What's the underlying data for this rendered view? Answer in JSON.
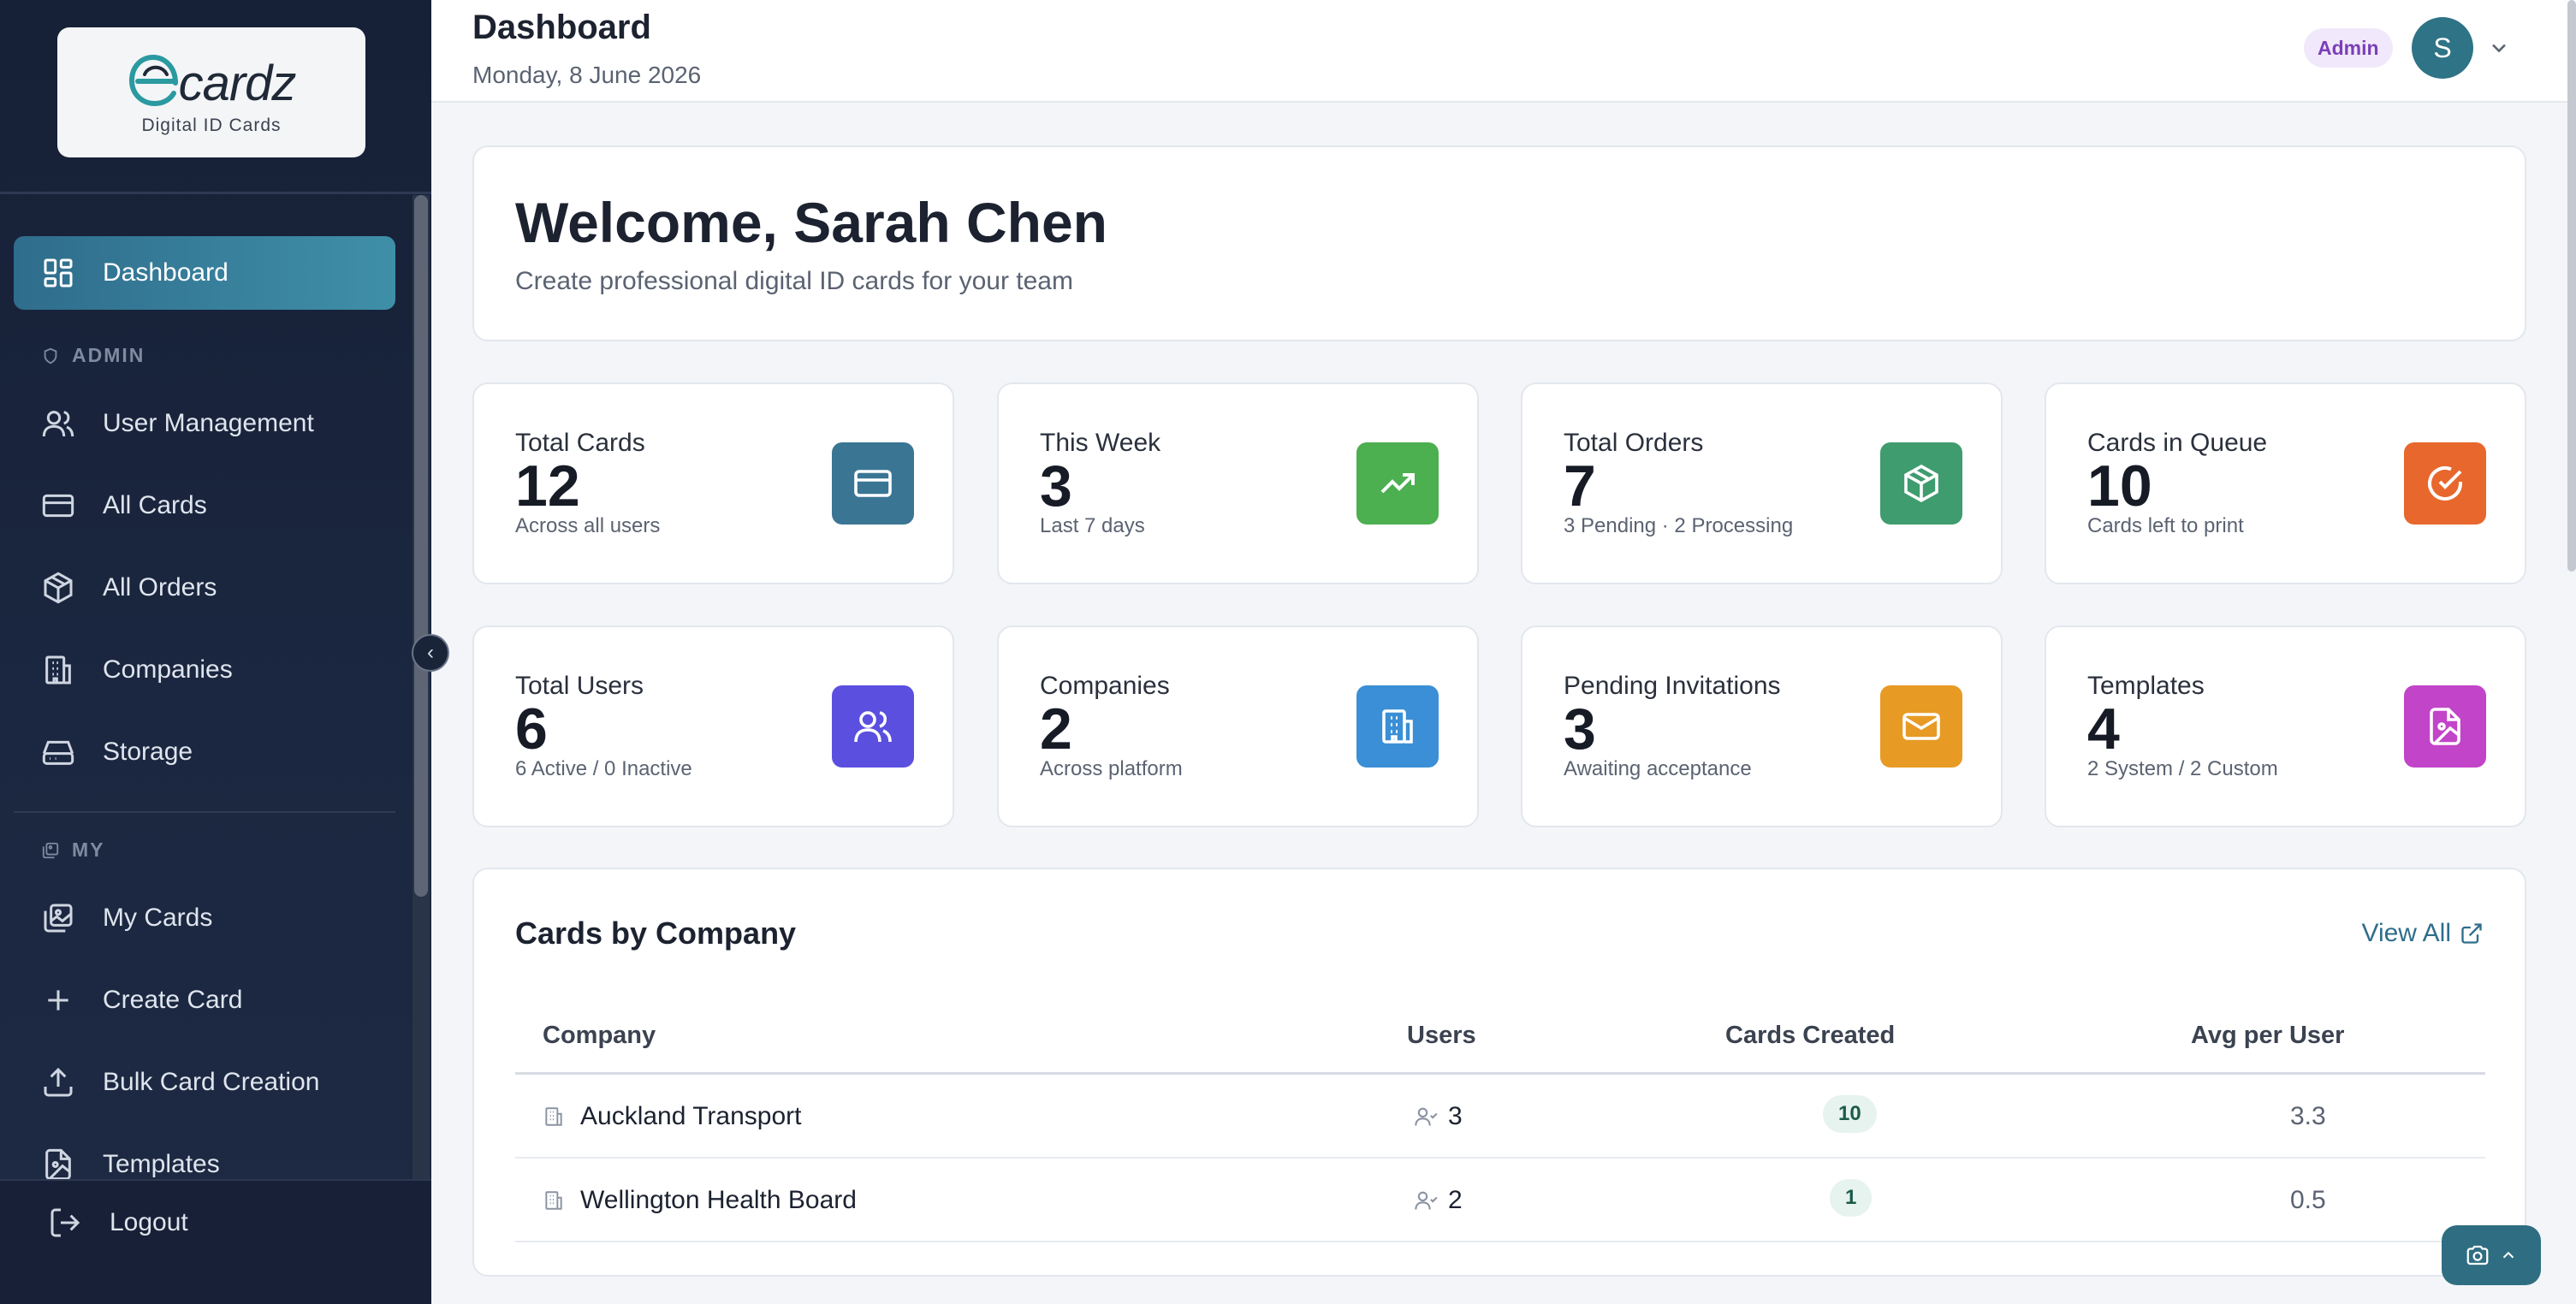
{
  "brand": {
    "logo_text": "cardz",
    "logo_letter": "e",
    "tagline": "Digital ID Cards"
  },
  "sidebar": {
    "dashboard": "Dashboard",
    "admin_label": "ADMIN",
    "admin_items": [
      "User Management",
      "All Cards",
      "All Orders",
      "Companies",
      "Storage"
    ],
    "my_label": "MY",
    "my_items": [
      "My Cards",
      "Create Card",
      "Bulk Card Creation",
      "Templates"
    ],
    "logout": "Logout",
    "collapse_glyph": "‹"
  },
  "header": {
    "title": "Dashboard",
    "date": "Monday, 8 June 2026",
    "role": "Admin",
    "avatar_initial": "S"
  },
  "welcome": {
    "heading": "Welcome, Sarah Chen",
    "subtitle": "Create professional digital ID cards for your team"
  },
  "stats": [
    {
      "label": "Total Cards",
      "value": "12",
      "sub": "Across all users",
      "icon": "credit-card-icon",
      "color": "#3a7594"
    },
    {
      "label": "This Week",
      "value": "3",
      "sub": "Last 7 days",
      "icon": "trending-up-icon",
      "color": "#4caf50"
    },
    {
      "label": "Total Orders",
      "value": "7",
      "sub": "3 Pending · 2 Processing",
      "icon": "package-icon",
      "color": "#3f9c6f"
    },
    {
      "label": "Cards in Queue",
      "value": "10",
      "sub": "Cards left to print",
      "icon": "check-circle-icon",
      "color": "#e8672c"
    },
    {
      "label": "Total Users",
      "value": "6",
      "sub": "6 Active / 0 Inactive",
      "icon": "users-icon",
      "color": "#5b4fe0"
    },
    {
      "label": "Companies",
      "value": "2",
      "sub": "Across platform",
      "icon": "building-icon",
      "color": "#3a8fd6"
    },
    {
      "label": "Pending Invitations",
      "value": "3",
      "sub": "Awaiting acceptance",
      "icon": "mail-icon",
      "color": "#e79a24"
    },
    {
      "label": "Templates",
      "value": "4",
      "sub": "2 System / 2 Custom",
      "icon": "file-image-icon",
      "color": "#c244c8"
    }
  ],
  "cards_by_company": {
    "title": "Cards by Company",
    "view_all": "View All",
    "columns": [
      "Company",
      "Users",
      "Cards Created",
      "Avg per User"
    ],
    "rows": [
      {
        "company": "Auckland Transport",
        "users": "3",
        "cards": "10",
        "avg": "3.3"
      },
      {
        "company": "Wellington Health Board",
        "users": "2",
        "cards": "1",
        "avg": "0.5"
      }
    ]
  },
  "colors": {
    "accent": "#2f6d8c",
    "sidebar_bg": "#1b2740",
    "admin_badge": "#7a3fb6"
  }
}
